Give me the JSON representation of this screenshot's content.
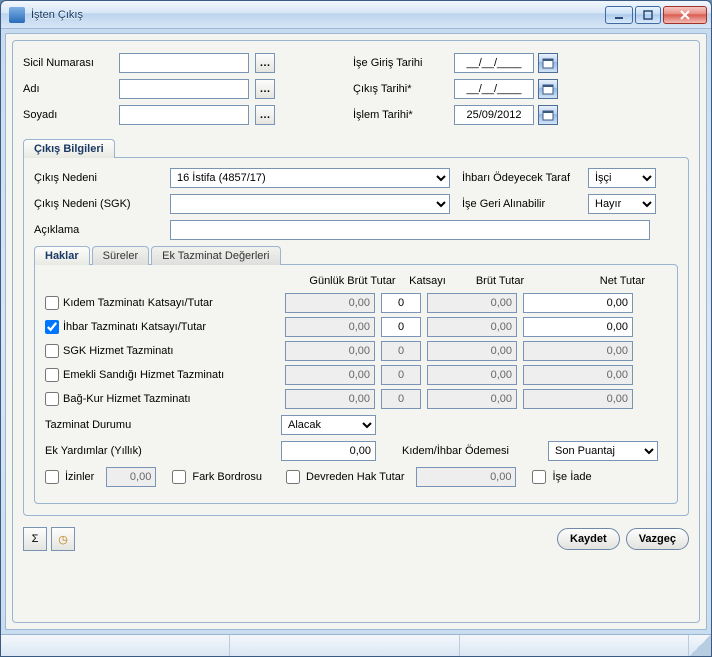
{
  "window": {
    "title": "İşten Çıkış"
  },
  "header": {
    "sicil_label": "Sicil Numarası",
    "adi_label": "Adı",
    "soyadi_label": "Soyadı",
    "ise_giris_label": "İşe Giriş Tarihi",
    "cikis_tarihi_label": "Çıkış Tarihi*",
    "islem_tarihi_label": "İşlem Tarihi*",
    "sicil_value": "",
    "adi_value": "",
    "soyadi_value": "",
    "ise_giris_value": "__/__/____",
    "cikis_tarihi_value": "__/__/____",
    "islem_tarihi_value": "25/09/2012"
  },
  "tab_main": {
    "label": "Çıkış Bilgileri"
  },
  "form": {
    "cikis_nedeni_label": "Çıkış Nedeni",
    "cikis_nedeni_value": "16 İstifa (4857/17)",
    "cikis_nedeni_sgk_label": "Çıkış Nedeni (SGK)",
    "cikis_nedeni_sgk_value": "",
    "aciklama_label": "Açıklama",
    "aciklama_value": "",
    "ihbari_label": "İhbarı Ödeyecek Taraf",
    "ihbari_value": "İşçi",
    "ise_geri_label": "İşe Geri Alınabilir",
    "ise_geri_value": "Hayır"
  },
  "tabs": {
    "haklar": "Haklar",
    "sureler": "Süreler",
    "ek": "Ek Tazminat Değerleri"
  },
  "cols": {
    "gunluk": "Günlük Brüt Tutar",
    "katsayi": "Katsayı",
    "brut": "Brüt Tutar",
    "net": "Net Tutar"
  },
  "rows": [
    {
      "label": "Kıdem Tazminatı Katsayı/Tutar",
      "checked": false,
      "gunluk": "0,00",
      "katsayi": "0",
      "brut": "0,00",
      "net": "0,00",
      "active_k": true
    },
    {
      "label": "İhbar Tazminatı Katsayı/Tutar",
      "checked": true,
      "gunluk": "0,00",
      "katsayi": "0",
      "brut": "0,00",
      "net": "0,00",
      "active_k": true
    },
    {
      "label": "SGK Hizmet Tazminatı",
      "checked": false,
      "gunluk": "0,00",
      "katsayi": "0",
      "brut": "0,00",
      "net": "0,00",
      "active_k": false
    },
    {
      "label": "Emekli Sandığı Hizmet Tazminatı",
      "checked": false,
      "gunluk": "0,00",
      "katsayi": "0",
      "brut": "0,00",
      "net": "0,00",
      "active_k": false
    },
    {
      "label": "Bağ-Kur Hizmet Tazminatı",
      "checked": false,
      "gunluk": "0,00",
      "katsayi": "0",
      "brut": "0,00",
      "net": "0,00",
      "active_k": false
    }
  ],
  "bottom": {
    "tazminat_durumu_label": "Tazminat Durumu",
    "tazminat_durumu_value": "Alacak",
    "ek_yardim_label": "Ek Yardımlar (Yıllık)",
    "ek_yardim_value": "0,00",
    "kidem_ihbar_label": "Kıdem/İhbar Ödemesi",
    "kidem_ihbar_value": "Son Puantaj",
    "izinler_label": "İzinler",
    "izinler_value": "0,00",
    "fark_label": "Fark Bordrosu",
    "devreden_label": "Devreden Hak Tutar",
    "devreden_value": "0,00",
    "ise_iade_label": "İşe İade"
  },
  "actions": {
    "kaydet": "Kaydet",
    "vazgec": "Vazgeç",
    "sigma": "Σ"
  }
}
